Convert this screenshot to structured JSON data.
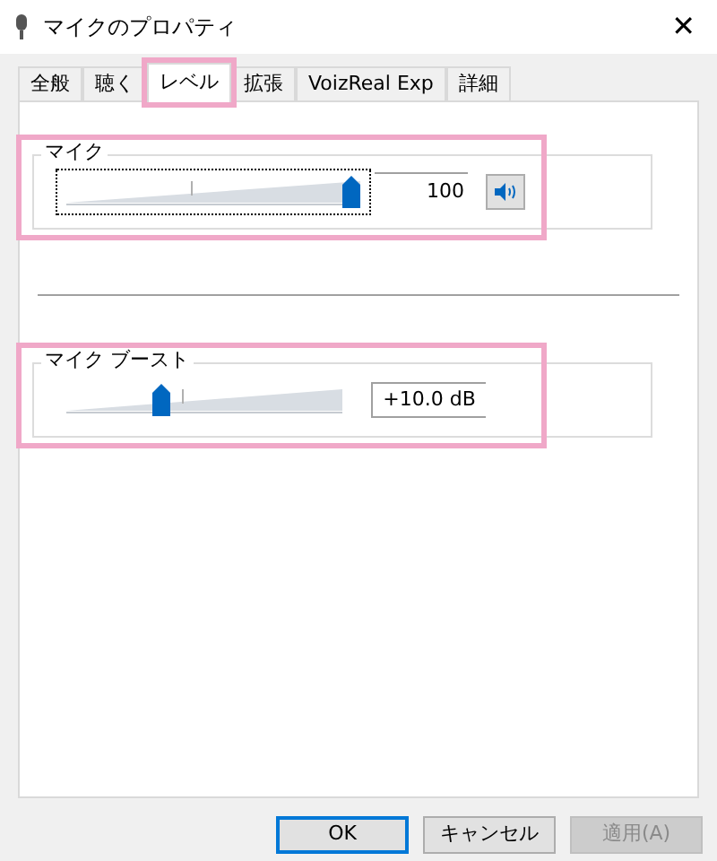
{
  "window": {
    "title": "マイクのプロパティ",
    "close": "✕"
  },
  "tabs": [
    {
      "label": "全般",
      "selected": false,
      "highlighted": false
    },
    {
      "label": "聴く",
      "selected": false,
      "highlighted": false
    },
    {
      "label": "レベル",
      "selected": true,
      "highlighted": true
    },
    {
      "label": "拡張",
      "selected": false,
      "highlighted": false
    },
    {
      "label": "VoizReal Exp",
      "selected": false,
      "highlighted": false
    },
    {
      "label": "詳細",
      "selected": false,
      "highlighted": false
    }
  ],
  "groups": [
    {
      "title": "マイク",
      "level": 1,
      "value": "100",
      "focused": true,
      "mute_button": true,
      "highlighted": true
    },
    {
      "title": "マイク ブースト",
      "level": 0.33,
      "value": "+10.0 dB",
      "focused": false,
      "mute_button": false,
      "highlighted": true
    }
  ],
  "buttons": [
    {
      "label": "OK",
      "default": true,
      "disabled": false
    },
    {
      "label": "キャンセル",
      "default": false,
      "disabled": false
    },
    {
      "label": "適用(A)",
      "default": false,
      "disabled": true
    }
  ]
}
